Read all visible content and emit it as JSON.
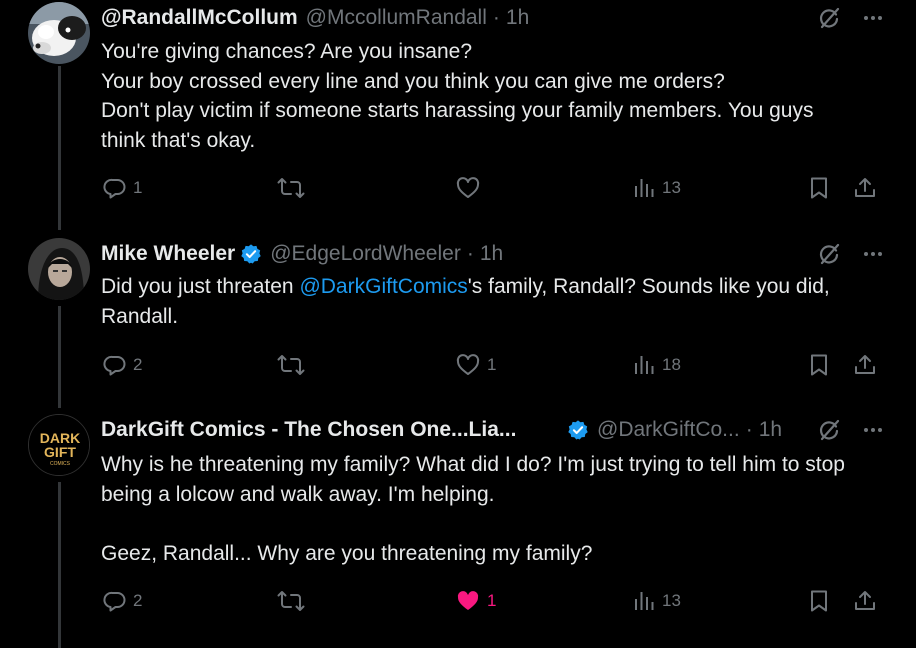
{
  "colors": {
    "background": "#000000",
    "text": "#e7e9ea",
    "muted": "#71767b",
    "link": "#1d9bf0",
    "verified": "#1d9bf0",
    "like": "#f91880",
    "thread_line": "#333639"
  },
  "tweets": [
    {
      "display_name": "@RandallMcCollum",
      "handle": "@MccollumRandall",
      "dot": "·",
      "time": "1h",
      "verified": false,
      "lines": [
        "You're giving chances? Are you insane?",
        "Your boy crossed every line and you think you can give me orders?",
        "Don't play victim if someone starts harassing your family members. You guys think that's okay."
      ],
      "replies": "1",
      "reposts": "",
      "likes": "",
      "liked": false,
      "views": "13",
      "icons": [
        "reply-icon",
        "repost-icon",
        "like-icon",
        "views-icon",
        "bookmark-icon",
        "share-icon",
        "grok-icon",
        "more-icon"
      ]
    },
    {
      "display_name": "Mike Wheeler",
      "handle": "@EdgeLordWheeler",
      "dot": "·",
      "time": "1h",
      "verified": true,
      "text_before": "Did you just threaten ",
      "mention": "@DarkGiftComics",
      "text_after": "'s family, Randall? Sounds like you did, Randall.",
      "replies": "2",
      "reposts": "",
      "likes": "1",
      "liked": false,
      "views": "18"
    },
    {
      "display_name": "DarkGift Comics - The Chosen One...Lia...",
      "handle": "@DarkGiftCo...",
      "dot": "·",
      "time": "1h",
      "verified": true,
      "avatar_text": [
        "DARK",
        "GIFT",
        "COMICS"
      ],
      "paragraphs": [
        "Why is he threatening my family? What did I do? I'm just trying to tell him to stop being a lolcow and walk away. I'm helping.",
        "Geez, Randall... Why are you threatening my family?"
      ],
      "replies": "2",
      "reposts": "",
      "likes": "1",
      "liked": true,
      "views": "13"
    }
  ]
}
